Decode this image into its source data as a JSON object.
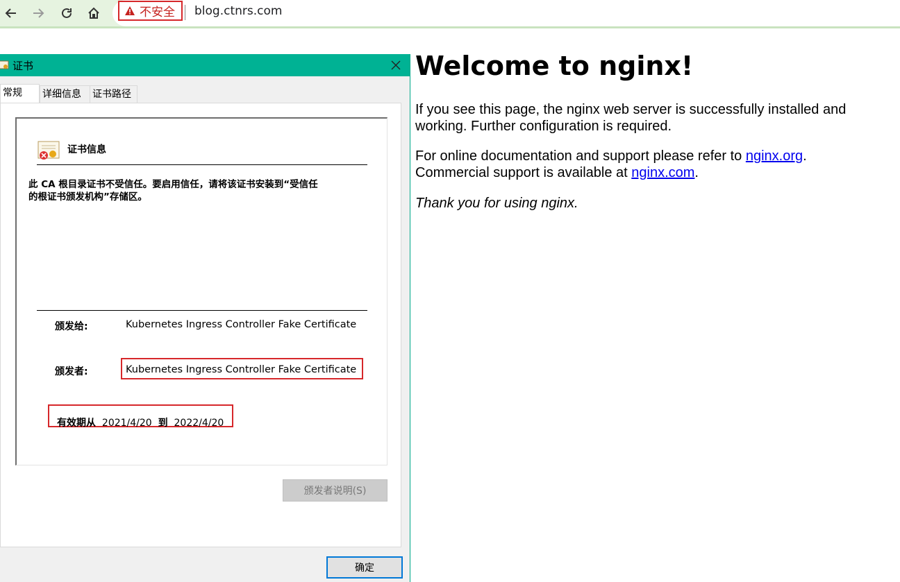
{
  "browser": {
    "security_label": "不安全",
    "url": "blog.ctnrs.com"
  },
  "dialog": {
    "title": "证书",
    "tabs": [
      "常规",
      "详细信息",
      "证书路径"
    ],
    "info_title": "证书信息",
    "warning": "此 CA 根目录证书不受信任。要启用信任，请将该证书安装到“受信任\n的根证书颁发机构”存储区。",
    "issued_to_label": "颁发给:",
    "issued_to_value": "Kubernetes Ingress Controller Fake Certificate",
    "issued_by_label": "颁发者:",
    "issued_by_value": "Kubernetes Ingress Controller Fake Certificate",
    "valid_from_label": "有效期从",
    "valid_from": "2021/4/20",
    "valid_to_label": "到",
    "valid_to": "2022/4/20",
    "issuer_statement_button": "颁发者说明(S)",
    "ok_button": "确定"
  },
  "page": {
    "heading": "Welcome to nginx!",
    "p1": "If you see this page, the nginx web server is successfully installed and working. Further configuration is required.",
    "p2_prefix": "For online documentation and support please refer to ",
    "link1": "nginx.org",
    "p2_mid_a": ".",
    "p2_mid_b": "Commercial support is available at ",
    "link2": "nginx.com",
    "p2_suffix": ".",
    "p3": "Thank you for using nginx."
  },
  "colors": {
    "titlebar": "#00b294",
    "warning_red": "#d6272a",
    "link": "#0000ee"
  }
}
